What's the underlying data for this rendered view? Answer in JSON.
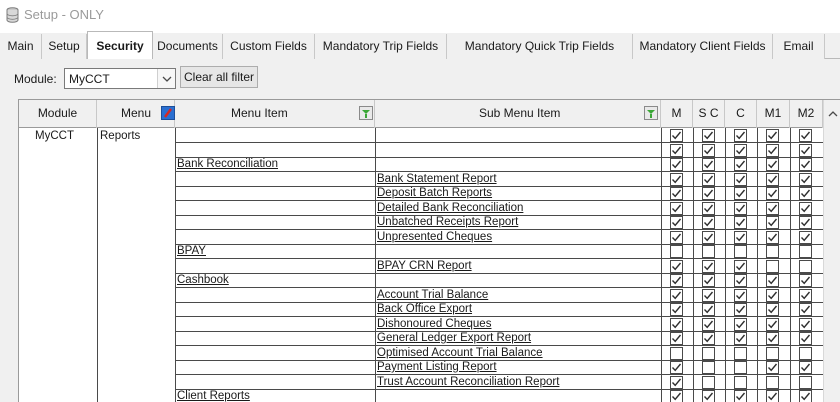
{
  "window": {
    "title": "Setup - ONLY"
  },
  "tabs": [
    {
      "label": "Main"
    },
    {
      "label": "Setup"
    },
    {
      "label": "Security"
    },
    {
      "label": "Documents"
    },
    {
      "label": "Custom Fields"
    },
    {
      "label": "Mandatory Trip Fields"
    },
    {
      "label": "Mandatory Quick Trip Fields"
    },
    {
      "label": "Mandatory Client Fields"
    },
    {
      "label": "Email"
    }
  ],
  "active_tab": "Security",
  "filter": {
    "module_label": "Module:",
    "module_value": "MyCCT",
    "clear_button": "Clear all filter"
  },
  "grid": {
    "headers": {
      "module": "Module",
      "menu": "Menu",
      "menu_item": "Menu Item",
      "sub_menu_item": "Sub Menu Item",
      "m": "M",
      "sc": "S C",
      "c": "C",
      "m1": "M1",
      "m2": "M2"
    },
    "module_value": "MyCCT",
    "menu_value": "Reports",
    "rows": [
      {
        "menu_item": "",
        "sub_menu_item": "",
        "checks": [
          true,
          true,
          true,
          true,
          true
        ]
      },
      {
        "menu_item": "",
        "sub_menu_item": "",
        "checks": [
          true,
          true,
          true,
          true,
          true
        ]
      },
      {
        "menu_item": "Bank Reconciliation",
        "sub_menu_item": "",
        "checks": [
          true,
          true,
          true,
          true,
          true
        ]
      },
      {
        "menu_item": "",
        "sub_menu_item": "Bank Statement Report",
        "checks": [
          true,
          true,
          true,
          true,
          true
        ]
      },
      {
        "menu_item": "",
        "sub_menu_item": "Deposit Batch Reports",
        "checks": [
          true,
          true,
          true,
          true,
          true
        ]
      },
      {
        "menu_item": "",
        "sub_menu_item": "Detailed Bank Reconciliation",
        "checks": [
          true,
          true,
          true,
          true,
          true
        ]
      },
      {
        "menu_item": "",
        "sub_menu_item": "Unbatched Receipts Report",
        "checks": [
          true,
          true,
          true,
          true,
          true
        ]
      },
      {
        "menu_item": "",
        "sub_menu_item": "Unpresented Cheques",
        "checks": [
          true,
          true,
          true,
          true,
          true
        ]
      },
      {
        "menu_item": "BPAY",
        "sub_menu_item": "",
        "checks": [
          false,
          false,
          false,
          false,
          false
        ]
      },
      {
        "menu_item": "",
        "sub_menu_item": "BPAY CRN Report",
        "checks": [
          true,
          true,
          true,
          false,
          false
        ]
      },
      {
        "menu_item": "Cashbook",
        "sub_menu_item": "",
        "checks": [
          true,
          true,
          true,
          true,
          true
        ]
      },
      {
        "menu_item": "",
        "sub_menu_item": "Account Trial Balance",
        "checks": [
          true,
          true,
          true,
          true,
          true
        ]
      },
      {
        "menu_item": "",
        "sub_menu_item": "Back Office Export",
        "checks": [
          true,
          true,
          true,
          true,
          true
        ]
      },
      {
        "menu_item": "",
        "sub_menu_item": "Dishonoured Cheques",
        "checks": [
          true,
          true,
          true,
          true,
          true
        ]
      },
      {
        "menu_item": "",
        "sub_menu_item": "General Ledger Export Report",
        "checks": [
          true,
          true,
          true,
          true,
          true
        ]
      },
      {
        "menu_item": "",
        "sub_menu_item": "Optimised Account Trial Balance",
        "checks": [
          false,
          false,
          false,
          false,
          false
        ]
      },
      {
        "menu_item": "",
        "sub_menu_item": "Payment Listing Report",
        "checks": [
          true,
          false,
          false,
          true,
          true
        ]
      },
      {
        "menu_item": "",
        "sub_menu_item": "Trust Account Reconciliation Report",
        "checks": [
          true,
          false,
          false,
          false,
          false
        ]
      },
      {
        "menu_item": "Client Reports",
        "sub_menu_item": "",
        "checks": [
          true,
          true,
          true,
          true,
          true
        ]
      }
    ]
  },
  "icons": {
    "window_icon": "database-icon",
    "menu_filter_icon": "filter-red-icon",
    "menu_item_filter_icon": "filter-green-icon",
    "sub_menu_item_filter_icon": "filter-green-icon",
    "dropdown_icon": "chevron-down-icon",
    "scroll_up_icon": "chevron-up-icon"
  },
  "colors": {
    "active_tab_bg": "#ffffff",
    "panel_bg": "#f0f0f0",
    "grid_line": "#4a4a4a",
    "filter_red": "#d9271e",
    "filter_blue": "#2a6fd1",
    "filter_green": "#3aa636"
  }
}
